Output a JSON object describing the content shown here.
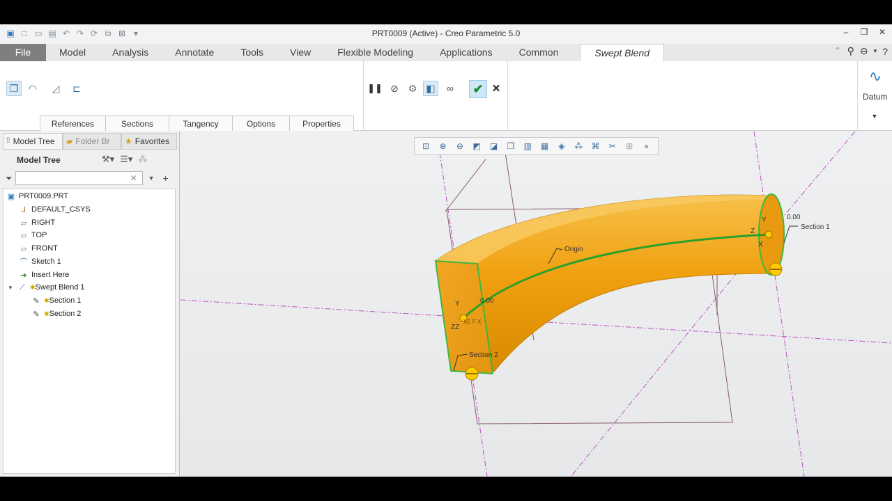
{
  "window": {
    "title": "PRT0009 (Active) - Creo Parametric 5.0"
  },
  "tabs": [
    {
      "label": "File"
    },
    {
      "label": "Model"
    },
    {
      "label": "Analysis"
    },
    {
      "label": "Annotate"
    },
    {
      "label": "Tools"
    },
    {
      "label": "View"
    },
    {
      "label": "Flexible Modeling"
    },
    {
      "label": "Applications"
    },
    {
      "label": "Common"
    },
    {
      "label": "Swept Blend"
    }
  ],
  "ribbon": {
    "subtabs": [
      "References",
      "Sections",
      "Tangency",
      "Options",
      "Properties"
    ],
    "datum_label": "Datum"
  },
  "left_panel": {
    "tabs": [
      "Model Tree",
      "Folder Br",
      "Favorites"
    ],
    "title": "Model Tree",
    "search_placeholder": ""
  },
  "tree": [
    {
      "label": "PRT0009.PRT",
      "icon": "part-icon"
    },
    {
      "label": "DEFAULT_CSYS",
      "icon": "csys-icon"
    },
    {
      "label": "RIGHT",
      "icon": "plane-icon"
    },
    {
      "label": "TOP",
      "icon": "plane-icon"
    },
    {
      "label": "FRONT",
      "icon": "plane-icon"
    },
    {
      "label": "Sketch 1",
      "icon": "sketch-icon"
    },
    {
      "label": "Insert Here",
      "icon": "insert-arrow-icon"
    },
    {
      "label": "Swept Blend 1",
      "icon": "swept-blend-icon"
    },
    {
      "label": "Section 1",
      "icon": "section-icon"
    },
    {
      "label": "Section 2",
      "icon": "section-icon"
    }
  ],
  "viewport": {
    "origin_label": "Origin",
    "section1_label": "Section 1",
    "section2_label": "Section 2",
    "dim1": "0.00",
    "dim2": "0.00",
    "axis_y": "Y",
    "axis_x": "X",
    "axis_z": "Z",
    "axis_zz": "ZZ",
    "axis_xe": "XE F X"
  },
  "colors": {
    "solid": "#f0a010",
    "trajectory": "#2aa02a",
    "datum_line": "#c050c0"
  }
}
